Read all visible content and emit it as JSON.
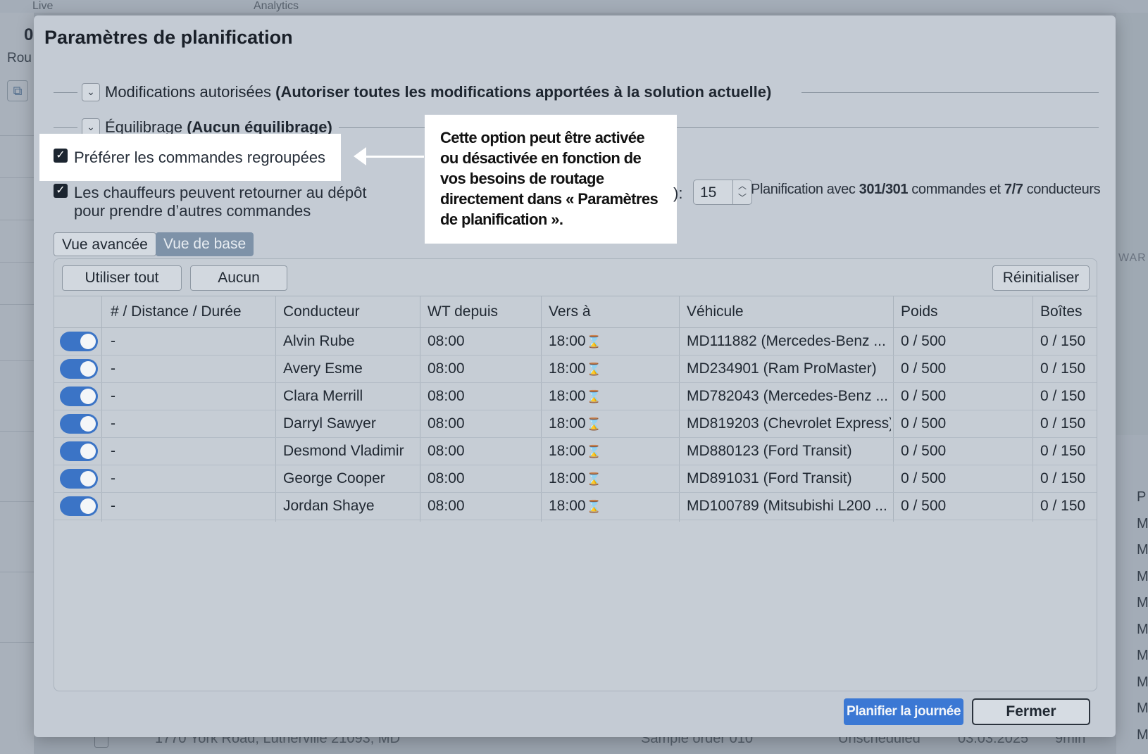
{
  "background": {
    "tabs": [
      "Live",
      "Analytics"
    ],
    "left_count": "0",
    "left_text": "Rou",
    "map_label": "WAR",
    "right_letters": [
      "P",
      "M",
      "M",
      "M",
      "M",
      "M",
      "M",
      "M",
      "M",
      "M"
    ],
    "bottom_row": {
      "address": "1770 York Road, Lutherville 21093, MD",
      "order": "Sample order 010",
      "status": "Unscheduled",
      "date": "03.03.2025",
      "duration": "9min"
    }
  },
  "dialog": {
    "title": "Paramètres de planification",
    "sections": [
      {
        "label": "Modifications autorisées",
        "value": "(Autoriser toutes les modifications apportées à la solution actuelle)"
      },
      {
        "label": "Équilibrage",
        "value": "(Aucun équilibrage)"
      }
    ],
    "options": {
      "prefer_grouped": {
        "label": "Préférer les commandes regroupées",
        "checked": true
      },
      "return_to_depot": {
        "line1": "Les chauffeurs peuvent retourner au dépôt",
        "line2": "pour prendre d’autres commandes",
        "checked": true
      }
    },
    "callout_text": "Cette option peut être activée ou désactivée en fonction de vos besoins de routage directement dans « Paramètres de planification ».",
    "cut_label": "):",
    "stepper_value": "15",
    "plan_info": {
      "prefix": "Planification avec",
      "orders": "301/301",
      "mid": "commandes et",
      "drivers": "7/7",
      "suffix": "conducteurs"
    },
    "views": {
      "advanced": "Vue avancée",
      "basic": "Vue de base",
      "active": "basic"
    },
    "panel": {
      "use_all": "Utiliser tout",
      "none": "Aucun",
      "reset": "Réinitialiser"
    },
    "columns": [
      "# / Distance / Durée",
      "Conducteur",
      "WT depuis",
      "Vers à",
      "Véhicule",
      "Poids",
      "Boîtes"
    ],
    "rows": [
      {
        "enabled": true,
        "distance": "-",
        "driver": "Alvin Rube",
        "from": "08:00",
        "to": "18:00",
        "vehicle": "MD111882 (Mercedes-Benz ...",
        "weight": "0 / 500",
        "boxes": "0 / 150"
      },
      {
        "enabled": true,
        "distance": "-",
        "driver": "Avery Esme",
        "from": "08:00",
        "to": "18:00",
        "vehicle": "MD234901 (Ram ProMaster)",
        "weight": "0 / 500",
        "boxes": "0 / 150"
      },
      {
        "enabled": true,
        "distance": "-",
        "driver": "Clara Merrill",
        "from": "08:00",
        "to": "18:00",
        "vehicle": "MD782043 (Mercedes-Benz ...",
        "weight": "0 / 500",
        "boxes": "0 / 150"
      },
      {
        "enabled": true,
        "distance": "-",
        "driver": "Darryl Sawyer",
        "from": "08:00",
        "to": "18:00",
        "vehicle": "MD819203 (Chevrolet Express)",
        "weight": "0 / 500",
        "boxes": "0 / 150"
      },
      {
        "enabled": true,
        "distance": "-",
        "driver": "Desmond Vladimir",
        "from": "08:00",
        "to": "18:00",
        "vehicle": "MD880123 (Ford Transit)",
        "weight": "0 / 500",
        "boxes": "0 / 150"
      },
      {
        "enabled": true,
        "distance": "-",
        "driver": "George Cooper",
        "from": "08:00",
        "to": "18:00",
        "vehicle": "MD891031 (Ford Transit)",
        "weight": "0 / 500",
        "boxes": "0 / 150"
      },
      {
        "enabled": true,
        "distance": "-",
        "driver": "Jordan Shaye",
        "from": "08:00",
        "to": "18:00",
        "vehicle": "MD100789 (Mitsubishi L200 ...",
        "weight": "0 / 500",
        "boxes": "0 / 150"
      }
    ],
    "footer": {
      "plan_day": "Planifier la journée",
      "close": "Fermer"
    },
    "colors": {
      "accent": "#3b78d4",
      "switch_on": "#3b74c6",
      "active_view": "#7e92a8"
    }
  }
}
